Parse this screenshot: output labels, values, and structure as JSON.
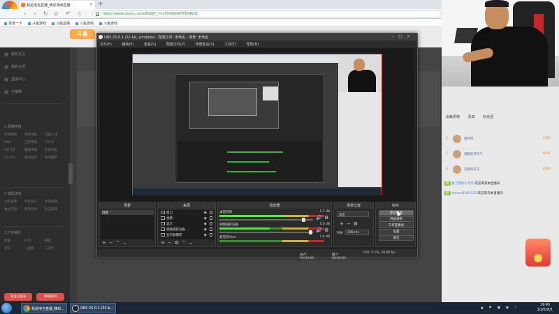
{
  "browser": {
    "tab_title": "我是电当直播_精彩游戏直播...",
    "url": "https://www.douyu.com/6626?_r=1304166470954605",
    "logo_label": "360安全浏览器",
    "bookmarks": [
      "百度一下",
      "斗鱼游戏",
      "斗鱼直播",
      "斗鱼游戏",
      "斗鱼游戏"
    ]
  },
  "sidebar": {
    "rows": [
      "我的关注",
      "我的订阅",
      "直播中心",
      "主播榜"
    ],
    "section1_title": "1 网游竞技",
    "grid1": [
      "英雄联盟",
      "绝地求生",
      "穿越火线",
      "DNF",
      "王者荣耀",
      "CSGO",
      "QQ飞车",
      "魔兽争霸",
      "炉石传说",
      "DOTA2",
      "我的世界",
      "和平精英"
    ],
    "section2_title": "2 单机游戏",
    "grid2": [
      "主机游戏",
      "单机热门",
      "怀旧经典",
      "独立游戏",
      "我的世界",
      "射击游戏"
    ],
    "section3_title": "3 户外娱乐",
    "grid3": [
      "颜值",
      "户外",
      "舞蹈",
      "音乐",
      "一起看",
      "二次元"
    ],
    "btn_left": "关注斗鱼号",
    "btn_right": "领取福利"
  },
  "ranking": [
    {
      "rank": "1",
      "name": "黄伟伟",
      "score": "4758"
    },
    {
      "rank": "2",
      "name": "温暖的坏天气",
      "score": "4001"
    },
    {
      "rank": "3",
      "name": "沉默的羔羊",
      "score": "2900"
    }
  ],
  "ranking_tabs": [
    "贡献周榜",
    "贵宾",
    "粉丝团"
  ],
  "chat": [
    {
      "user": "张了我的小可乃",
      "text": "欢迎来到本直播间"
    },
    {
      "user": "nohero1993123",
      "text": "欢迎来到本直播间"
    }
  ],
  "obs": {
    "title": "OBS 25.0.1 (32-bit, windows) - 配置文件: 未命名 - 场景: 未命名",
    "menu": [
      "文件(F)",
      "编辑(E)",
      "查看(V)",
      "配置文件(P)",
      "场景集合(S)",
      "工具(T)",
      "帮助(H)"
    ],
    "scenes_title": "场景",
    "scene_item": "场景",
    "sources_title": "来源",
    "sources": [
      "窗口",
      "视频",
      "显示",
      "视频捕获设备",
      "显示器捕获"
    ],
    "mixer_title": "混音器",
    "mixer": [
      {
        "label": "桌面音频",
        "db": "-1.7 dB",
        "level": 0.62
      },
      {
        "label": "视频捕获设备",
        "db": "0.0 dB",
        "level": 0.48
      },
      {
        "label": "麦克风/Aux",
        "db": "1.4 dB",
        "level": 0.0
      }
    ],
    "transitions_title": "场景过渡",
    "transition_value": "淡出",
    "duration_label": "时长",
    "duration_value": "300 ms",
    "controls_title": "控件",
    "controls": [
      "停止推流",
      "开始录制",
      "工作室模式",
      "设置",
      "退出"
    ],
    "status_live": "LIVE: 00:00:00",
    "status_rec": "REC: 00:00:00",
    "status_cpu": "CPU: 5.1%, 30.00 fps"
  },
  "taskbar": {
    "items": [
      "我是电当直播_精彩...",
      "OBS 25.0.1 (32-b..."
    ],
    "time": "19:45",
    "date": "2021/8/1"
  }
}
